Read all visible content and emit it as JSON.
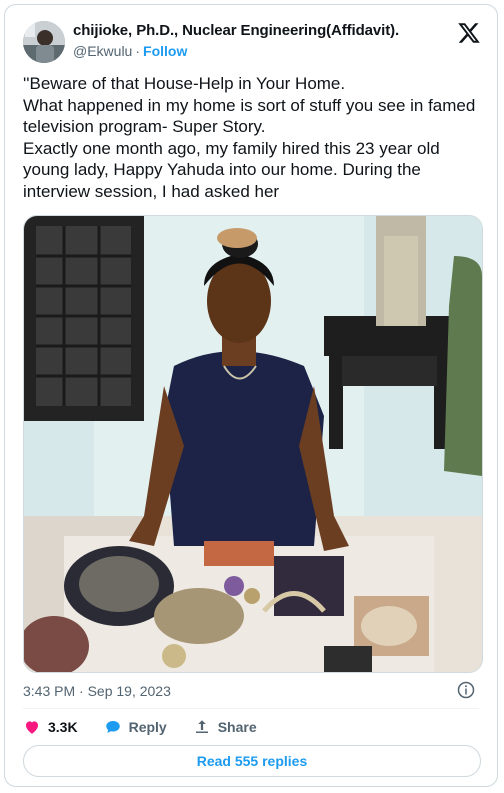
{
  "author": {
    "name": "chijioke, Ph.D., Nuclear Engineering(Affidavit).",
    "handle": "@Ekwulu",
    "separator": "·",
    "follow_label": "Follow"
  },
  "platform_icon": "x-logo-icon",
  "tweet": {
    "text": "''Beware of that House-Help in Your Home.\nWhat happened in my home is sort of stuff you see in famed television program- Super Story.\nExactly one month ago, my family hired this 23 year old young lady, Happy Yahuda  into our home. During the interview session, I had asked her",
    "media_description_icon": "photo"
  },
  "meta": {
    "timestamp": "3:43 PM · Sep 19, 2023",
    "info_icon": "info-icon"
  },
  "actions": {
    "like_count": "3.3K",
    "reply_label": "Reply",
    "share_label": "Share"
  },
  "read_replies_label": "Read 555 replies",
  "colors": {
    "accent": "#1d9bf0",
    "like": "#f91880",
    "text": "#0f1419",
    "muted": "#536471",
    "border": "#cfd9de"
  }
}
